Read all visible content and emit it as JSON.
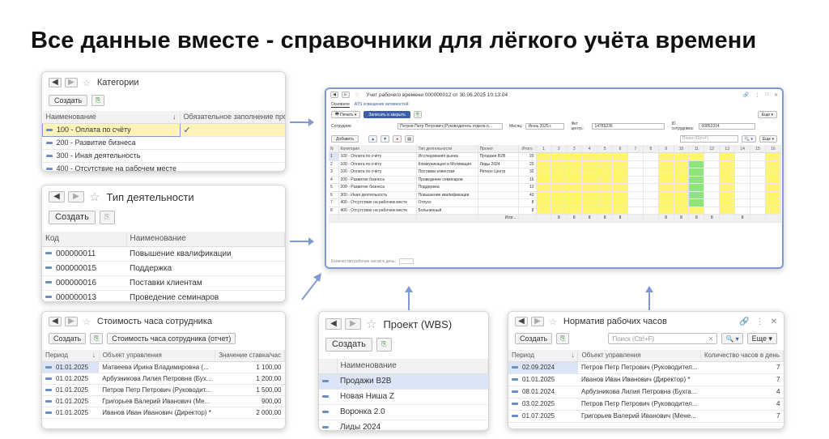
{
  "headline": "Все данные вместе - справочники для лёгкого учёта времени",
  "common": {
    "create": "Создать",
    "search": "Поиск (Ctrl+F)",
    "more": "Еще"
  },
  "categories": {
    "title": "Категории",
    "columns": [
      "Наименование",
      "Обязательное заполнение проекта"
    ],
    "rows": [
      {
        "name": "100 - Оплата по счёту",
        "check": "✓"
      },
      {
        "name": "200 - Развитие бизнеса",
        "check": ""
      },
      {
        "name": "300 - Иная деятельность",
        "check": ""
      },
      {
        "name": "400 - Отсутствие на рабочем месте",
        "check": ""
      }
    ]
  },
  "activity": {
    "title": "Тип деятельности",
    "columns": [
      "Код",
      "Наименование"
    ],
    "rows": [
      {
        "code": "000000011",
        "name": "Повышение квалификации"
      },
      {
        "code": "000000015",
        "name": "Поддержка"
      },
      {
        "code": "000000016",
        "name": "Поставки клиентам"
      },
      {
        "code": "000000013",
        "name": "Проведение семинаров"
      }
    ]
  },
  "rate": {
    "title": "Стоимость часа сотрудника",
    "report_button": "Стоимость часа сотрудника (отчет)",
    "columns": [
      "Период",
      "Объект управления",
      "Значение ставка/час"
    ],
    "rows": [
      {
        "period": "01.01.2025",
        "object": "Матвеева Ирина Владимировна (...",
        "value": "1 100,00"
      },
      {
        "period": "01.01.2025",
        "object": "Арбузникова Лилия Петровна (Бух...",
        "value": "1 200,00"
      },
      {
        "period": "01.01.2025",
        "object": "Петров Петр Петрович (Руководит...",
        "value": "1 500,00"
      },
      {
        "period": "01.01.2025",
        "object": "Григорьев Валерий Иванович (Ме...",
        "value": "900,00"
      },
      {
        "period": "01.01.2025",
        "object": "Иванов Иван Иванович (Директор) *",
        "value": "2 000,00"
      }
    ]
  },
  "wbs": {
    "title": "Проект (WBS)",
    "columns": [
      "Наименование"
    ],
    "rows": [
      "Продажи B2B",
      "Новая Ниша Z",
      "Воронка 2.0",
      "Лиды 2024"
    ]
  },
  "norm": {
    "title": "Норматив рабочих часов",
    "columns": [
      "Период",
      "Объект управления",
      "Количество часов в день"
    ],
    "rows": [
      {
        "period": "02.09.2024",
        "object": "Петров Петр Петрович (Руководител...",
        "hours": "7"
      },
      {
        "period": "01.01.2025",
        "object": "Иванов Иван Иванович (Директор) *",
        "hours": "7"
      },
      {
        "period": "08.01.2024",
        "object": "Арбузникова Лилия Петровна (Бухга...",
        "hours": "4"
      },
      {
        "period": "03.02.2025",
        "object": "Петров Петр Петрович (Руководител...",
        "hours": "4"
      },
      {
        "period": "01.07.2025",
        "object": "Григорьев Валерий Иванович (Мене...",
        "hours": "7"
      }
    ]
  },
  "timesheet": {
    "title": "Учет рабочего времени 000000012 от 30.06.2025 10:13:04",
    "tabs": [
      "Основное",
      "АТS освещение активностей"
    ],
    "print": "Печать",
    "save_close": "Записать и закрыть",
    "employee_label": "Сотрудник:",
    "employee": "Петров Петр Петрович (Руководитель отдела п...",
    "month_label": "Месяц:",
    "month": "Июнь 2025 г.",
    "center_label": "Фкт центр.:",
    "center": "14785236",
    "id_label": "ID сотрудника:",
    "id": "00852314",
    "add": "Добавить",
    "columns": [
      "N",
      "Категория",
      "Тип деятельности",
      "Проект",
      "Итого",
      "1",
      "2",
      "3",
      "4",
      "5",
      "6",
      "7",
      "8",
      "9",
      "10",
      "11",
      "12",
      "13",
      "14",
      "15",
      "16"
    ],
    "rows": [
      {
        "n": "1",
        "cat": "100 - Оплата по счёту",
        "type": "Исследования рынка",
        "proj": "Продажи B2B",
        "total": "20"
      },
      {
        "n": "2",
        "cat": "100 - Оплата по счёту",
        "type": "Коммуникация и Мотивация",
        "proj": "Лиды 2024",
        "total": "20"
      },
      {
        "n": "3",
        "cat": "100 - Оплата по счёту",
        "type": "Поставки клиентам",
        "proj": "Регион Центр",
        "total": "32"
      },
      {
        "n": "4",
        "cat": "200 - Развитие бизнеса",
        "type": "Проведение семинаров",
        "proj": "",
        "total": "16"
      },
      {
        "n": "5",
        "cat": "200 - Развитие бизнеса",
        "type": "Поддержка",
        "proj": "",
        "total": "12"
      },
      {
        "n": "6",
        "cat": "300 - Иная деятельность",
        "type": "Повышение квалификации",
        "proj": "",
        "total": "43"
      },
      {
        "n": "7",
        "cat": "400 - Отсутствие на рабочем месте",
        "type": "Отпуск",
        "proj": "",
        "total": "8"
      },
      {
        "n": "8",
        "cat": "400 - Отсутствие на рабочем месте",
        "type": "Больничный",
        "proj": "",
        "total": "8"
      }
    ],
    "footer_label": "Итог...",
    "day_totals": [
      "",
      "8",
      "8",
      "8",
      "8",
      "8",
      "",
      "",
      "8",
      "8",
      "8",
      "8",
      "",
      "8",
      "",
      ""
    ],
    "bottom_label": "Количество рабочих часов в день:"
  }
}
